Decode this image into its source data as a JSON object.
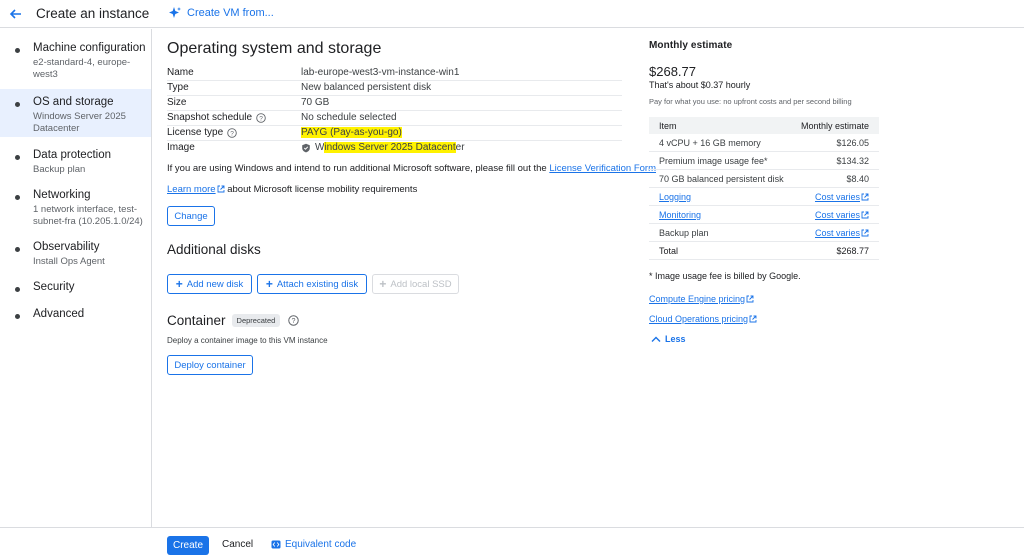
{
  "header": {
    "title": "Create an instance",
    "create_from": "Create VM from..."
  },
  "sidebar": {
    "items": [
      {
        "label": "Machine configuration",
        "sub": "e2-standard-4, europe-west3"
      },
      {
        "label": "OS and storage",
        "sub": "Windows Server 2025 Datacenter"
      },
      {
        "label": "Data protection",
        "sub": "Backup plan"
      },
      {
        "label": "Networking",
        "sub": "1 network interface, test-subnet-fra (10.205.1.0/24)"
      },
      {
        "label": "Observability",
        "sub": "Install Ops Agent"
      },
      {
        "label": "Security",
        "sub": ""
      },
      {
        "label": "Advanced",
        "sub": ""
      }
    ]
  },
  "os_storage": {
    "title": "Operating system and storage",
    "rows": [
      {
        "key": "Name",
        "value": "lab-europe-west3-vm-instance-win1"
      },
      {
        "key": "Type",
        "value": "New balanced persistent disk"
      },
      {
        "key": "Size",
        "value": "70 GB"
      },
      {
        "key": "Snapshot schedule",
        "value": "No schedule selected"
      },
      {
        "key": "License type",
        "value": "PAYG (Pay-as-you-go)"
      },
      {
        "key": "Image",
        "value_pre": "W",
        "value_hl": "indows Server 2025 Datacent",
        "value_post": "er"
      }
    ],
    "windows_note": "If you are using Windows and intend to run additional Microsoft software, please fill out the",
    "license_form_link": "License Verification Form",
    "learn_more_link": "Learn more",
    "learn_more_text": "about Microsoft license mobility requirements",
    "change_button": "Change"
  },
  "additional_disks": {
    "title": "Additional disks",
    "add_new": "Add new disk",
    "attach_existing": "Attach existing disk",
    "add_local_ssd": "Add local SSD"
  },
  "container": {
    "title": "Container",
    "badge": "Deprecated",
    "description": "Deploy a container image to this VM instance",
    "deploy_button": "Deploy container"
  },
  "estimate": {
    "title": "Monthly estimate",
    "total_big": "$268.77",
    "hourly": "That's about $0.37 hourly",
    "note": "Pay for what you use: no upfront costs and per second billing",
    "col_item": "Item",
    "col_estimate": "Monthly estimate",
    "rows": [
      {
        "item": "4 vCPU + 16 GB memory",
        "cost": "$126.05",
        "link": false
      },
      {
        "item": "Premium image usage fee*",
        "cost": "$134.32",
        "link": false
      },
      {
        "item": "70 GB balanced persistent disk",
        "cost": "$8.40",
        "link": false
      },
      {
        "item": "Logging",
        "cost": "Cost varies",
        "link": true
      },
      {
        "item": "Monitoring",
        "cost": "Cost varies",
        "link": true
      },
      {
        "item": "Backup plan",
        "cost": "Cost varies",
        "link": true
      },
      {
        "item": "Total",
        "cost": "$268.77",
        "link": false
      }
    ],
    "footnote": "* Image usage fee is billed by Google.",
    "compute_pricing": "Compute Engine pricing",
    "ops_pricing": "Cloud Operations pricing",
    "less": "Less"
  },
  "footer": {
    "create": "Create",
    "cancel": "Cancel",
    "equivalent_code": "Equivalent code"
  },
  "colors": {
    "accent": "#1a73e8",
    "highlight": "#fff200",
    "active_nav": "#e8f0fe"
  }
}
